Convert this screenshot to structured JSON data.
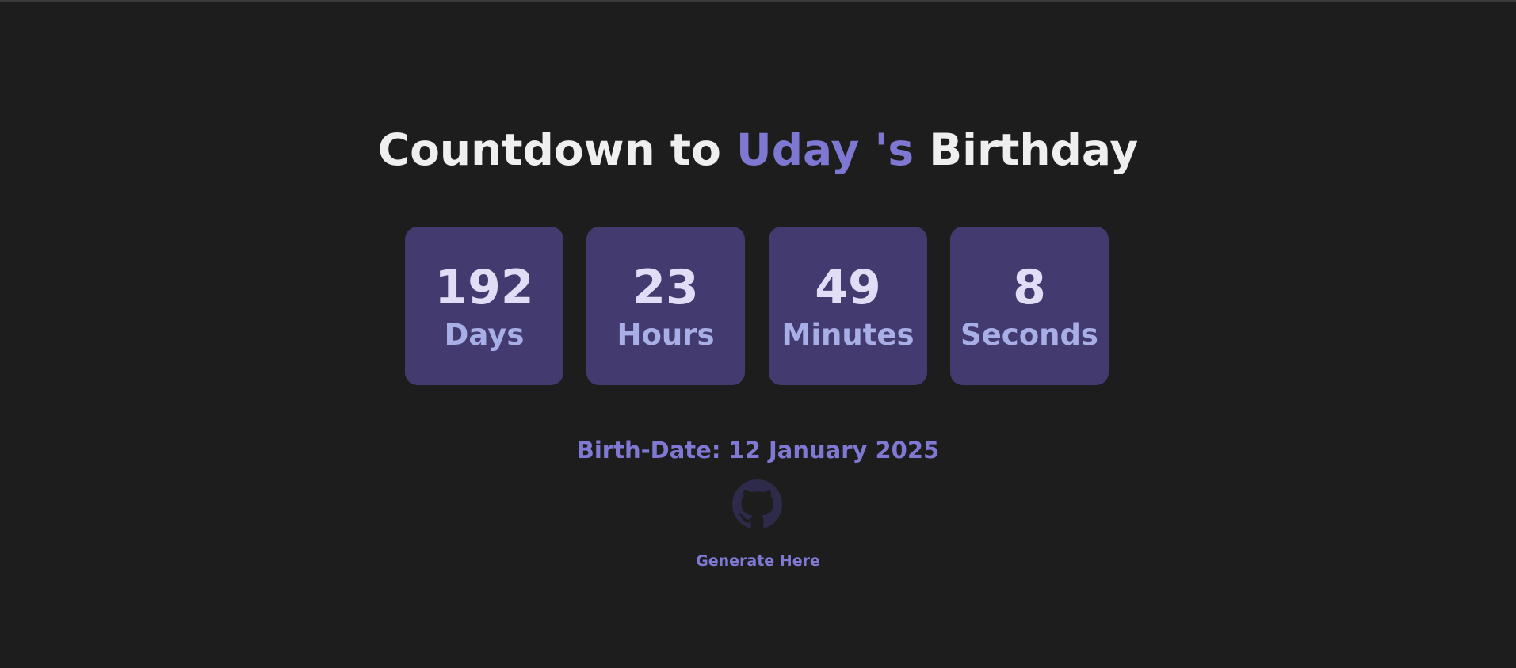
{
  "header": {
    "title_prefix": "Countdown to ",
    "name": "Uday 's",
    "title_suffix": " Birthday"
  },
  "countdown": [
    {
      "value": "192",
      "label": "Days"
    },
    {
      "value": "23",
      "label": "Hours"
    },
    {
      "value": "49",
      "label": "Minutes"
    },
    {
      "value": "8",
      "label": "Seconds"
    }
  ],
  "birthdate": {
    "text": "Birth-Date: 12 January 2025"
  },
  "links": {
    "github_icon": "github-icon",
    "generate_label": "Generate Here"
  },
  "colors": {
    "background": "#1d1d1d",
    "accent": "#7e78d2",
    "tile": "#433b6f",
    "number": "#e2ddf7",
    "unit": "#a8aee6"
  }
}
